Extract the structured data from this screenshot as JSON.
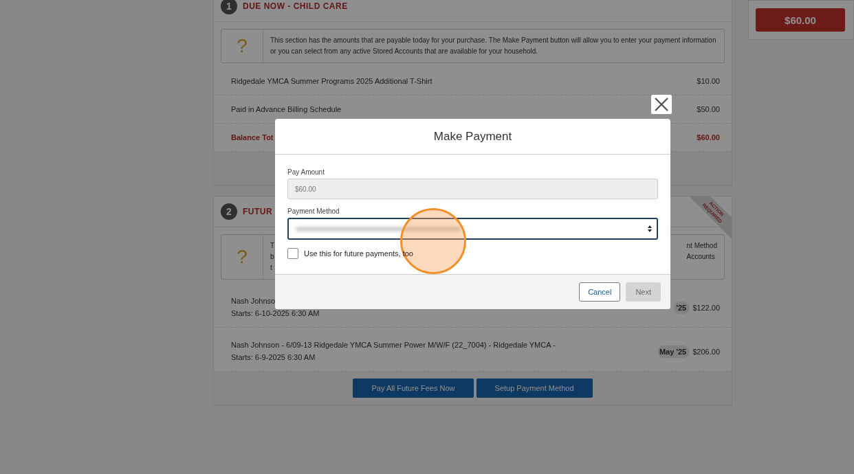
{
  "sections": [
    {
      "number": "1",
      "title": "DUE NOW - CHILD CARE",
      "help_glyph": "?",
      "info_left": [
        "This section has the amounts that are payable today for your purchase. The Make Payment button will allow you to enter your payment information or you can select from any active Stored Accounts that are available for your household."
      ],
      "rows": [
        {
          "kind": "line",
          "title": "Ridgedale YMCA Summer Programs 2025 Additional T-Shirt",
          "amount": "$10.00"
        },
        {
          "kind": "line",
          "title": "Paid in Advance Billing Schedule",
          "amount": "$50.00"
        },
        {
          "kind": "total",
          "title": "Balance Tot",
          "amount": "$60.00"
        }
      ]
    },
    {
      "number": "2",
      "title": "FUTUR",
      "ribbon": [
        "ACTION",
        "REQUIRED"
      ],
      "help_glyph": "?",
      "info_left": [
        "T",
        "b",
        "t"
      ],
      "info_right": [
        "nt Method",
        "Accounts"
      ],
      "rows": [
        {
          "kind": "fee",
          "title": "Nash Johnso",
          "sub": "Starts: 6-10-2025 6:30 AM",
          "month": "'25",
          "amount": "$122.00"
        },
        {
          "kind": "fee",
          "title": "Nash Johnson - 6/09-13 Ridgedale YMCA Summer Power M/W/F (22_7004) - Ridgedale YMCA -",
          "sub": "Starts: 6-9-2025 6:30 AM",
          "month": "May '25",
          "amount": "$206.00"
        }
      ],
      "buttons": [
        "Pay All Future Fees Now",
        "Setup Payment Method"
      ]
    }
  ],
  "sidebar": {
    "total": "$60.00"
  },
  "modal": {
    "title": "Make Payment",
    "pay_amount_label": "Pay Amount",
    "pay_amount": "$60.00",
    "method_label": "Payment Method",
    "future_checkbox": {
      "label": "Use this for future payments, too",
      "checked": false
    },
    "cancel": "Cancel",
    "next": {
      "label": "Next",
      "disabled": true
    }
  }
}
